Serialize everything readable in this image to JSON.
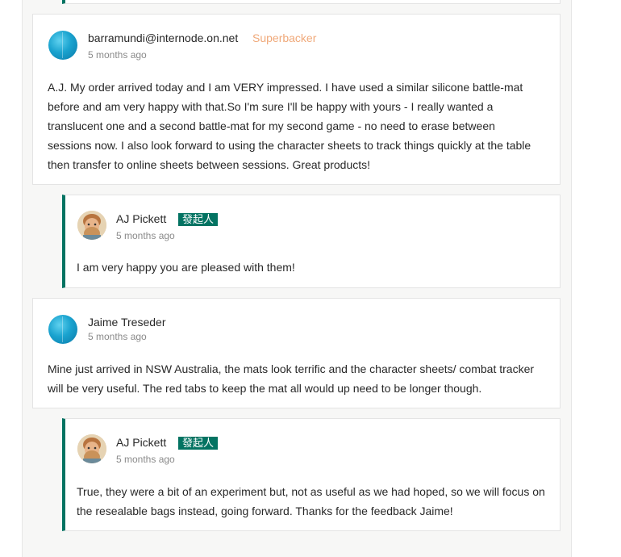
{
  "comments": [
    {
      "author": "barramundi@internode.on.net",
      "badge": "Superbacker",
      "time": "5 months ago",
      "text": "A.J. My order arrived today and I am VERY impressed. I have used a similar silicone battle-mat before and am very happy with that.So I'm sure I'll be happy with yours - I really wanted a translucent one and a second battle-mat for my second game - no need to erase between sessions now. I also look forward to using the character sheets to track things quickly at the table then transfer to online sheets between sessions. Great products!",
      "avatar_icon": "blue-circle-avatar",
      "reply": {
        "author": "AJ Pickett",
        "badge": "發起人",
        "time": "5 months ago",
        "text": "I am very happy you are pleased with them!",
        "avatar_icon": "illustrated-face-avatar"
      }
    },
    {
      "author": "Jaime Treseder",
      "badge": "",
      "time": "5 months ago",
      "text": "Mine just arrived in NSW Australia, the mats look terrific and the character sheets/ combat tracker will be very useful. The red tabs to keep the mat all would up need to be longer though.",
      "avatar_icon": "blue-circle-avatar",
      "reply": {
        "author": "AJ Pickett",
        "badge": "發起人",
        "time": "5 months ago",
        "text": "True, they were a bit of an experiment but, not as useful as we had hoped, so we will focus on the resealable bags instead, going forward. Thanks for the feedback Jaime!",
        "avatar_icon": "illustrated-face-avatar"
      }
    }
  ],
  "colors": {
    "creator_green": "#037362",
    "superbacker": "#f0a97a",
    "muted_text": "#8a8a8a"
  }
}
